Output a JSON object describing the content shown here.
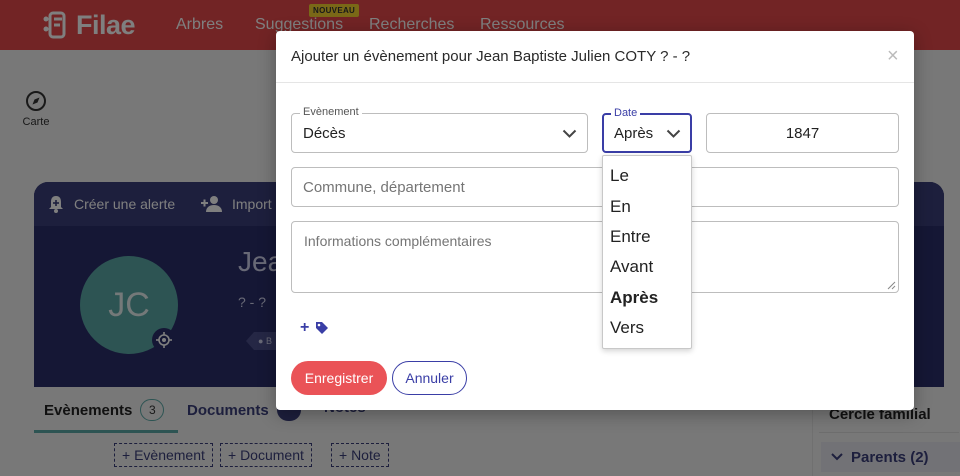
{
  "app": {
    "logo_text": "Filae",
    "nav": [
      "Arbres",
      "Suggestions",
      "Recherches",
      "Ressources"
    ],
    "new_badge": "NOUVEAU"
  },
  "left_tools": {
    "carte_label": "Carte"
  },
  "profile": {
    "toolbar": [
      "Créer une alerte",
      "Import"
    ],
    "avatar_initials": "JC",
    "name_partial": "Jea",
    "dates": "? - ?",
    "tag_partial": "B"
  },
  "tabs": [
    {
      "label": "Evènements",
      "count": "3"
    },
    {
      "label": "Documents",
      "count": ""
    },
    {
      "label": "Notes"
    }
  ],
  "add_buttons": [
    "+ Evènement",
    "+ Document",
    "+ Note"
  ],
  "cercle": {
    "title": "Cercle familial",
    "parents": "Parents (2)"
  },
  "modal": {
    "title": "Ajouter un évènement pour Jean Baptiste Julien COTY ? - ?",
    "close": "×",
    "event": {
      "legend": "Evènement",
      "value": "Décès"
    },
    "date": {
      "legend": "Date",
      "value": "Après"
    },
    "year": {
      "value": "1847"
    },
    "commune_placeholder": "Commune, département",
    "info_placeholder": "Informations complémentaires",
    "tag_plus": "+",
    "save_label": "Enregistrer",
    "cancel_label": "Annuler",
    "date_options": [
      "Le",
      "En",
      "Entre",
      "Avant",
      "Après",
      "Vers"
    ],
    "date_selected_index": 4
  },
  "colors": {
    "brand_red": "#e4484a",
    "navy": "#2b2f6b",
    "accent_blue": "#3a3ea6",
    "save_red": "#ea5357",
    "teal": "#5aa8a6"
  }
}
